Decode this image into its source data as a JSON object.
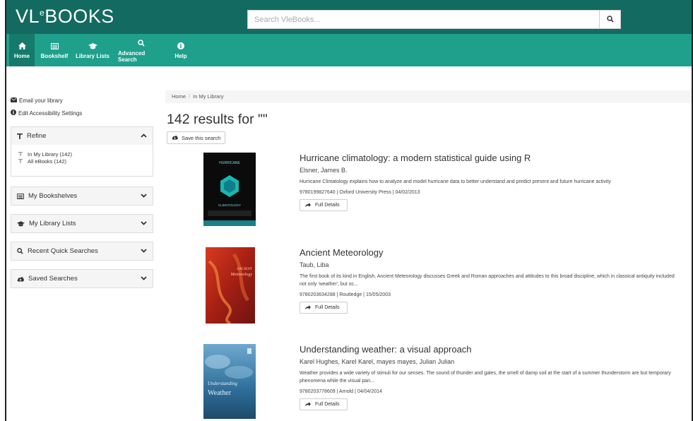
{
  "header": {
    "logo": "VLeBOOKS",
    "search_placeholder": "Search VleBooks...",
    "search_icon": "search-icon"
  },
  "nav": [
    {
      "label": "Home",
      "icon": "home-icon"
    },
    {
      "label": "Bookshelf",
      "icon": "bookshelf-icon"
    },
    {
      "label": "Library Lists",
      "icon": "graduation-cap-icon"
    },
    {
      "label": "Advanced Search",
      "icon": "search-icon"
    },
    {
      "label": "Help",
      "icon": "info-icon"
    }
  ],
  "sidebar": {
    "email_link": "Email your library",
    "accessibility_link": "Edit Accessibility Settings",
    "refine": {
      "title": "Refine",
      "items": [
        "In My Library (142)",
        "All eBooks (142)"
      ]
    },
    "panels": [
      "My Bookshelves",
      "My Library Lists",
      "Recent Quick Searches",
      "Saved Searches"
    ]
  },
  "breadcrumb": {
    "home": "Home",
    "separator": "/",
    "current": "In My Library"
  },
  "results": {
    "title": "142 results for \"\"",
    "save_label": "Save this search"
  },
  "books": [
    {
      "title": "Hurricane climatology: a modern statistical guide using R",
      "author": "Elsner, James B.",
      "description": "Hurricane Climatology explains how to analyze and model hurricane data to better understand and predict present and future hurricane activity",
      "meta": "9780199827640 | Oxford University Press | 04/02/2013",
      "details_label": "Full Details",
      "cover_text": "HURRICANE CLIMATOLOGY"
    },
    {
      "title": "Ancient Meteorology",
      "author": "Taub, Liba",
      "description": "The first book of its kind in English, Ancient Meteorology discusses Greek and Roman approaches and attitudes to this broad discipline, which in classical antiquity included not only 'weather', but oc...",
      "meta": "9780203634288 | Routledge | 15/05/2003",
      "details_label": "Full Details",
      "cover_text": "ANCIENT Meteorology"
    },
    {
      "title": "Understanding weather: a visual approach",
      "author": "Karel Hughes, Karel Karel, mayes mayes, Julian Julian",
      "description": "Weather provides a wide variety of stimuli for our senses. The sound of thunder and gales, the smell of damp soil at the start of a summer thunderstorm are but temporary phenomena while the visual pan...",
      "meta": "9780203778609 | Arnold | 04/04/2014",
      "details_label": "Full Details",
      "cover_text": "Understanding Weather"
    }
  ],
  "colors": {
    "topbar": "#136a60",
    "navbar": "#1ea08c",
    "nav_active": "#157a6b"
  }
}
